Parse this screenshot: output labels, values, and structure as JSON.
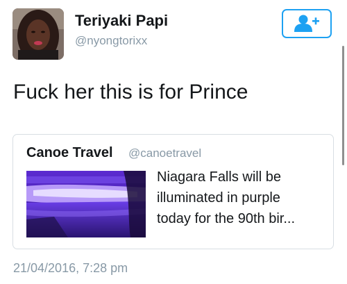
{
  "author": {
    "name": "Teriyaki Papi",
    "handle": "@nyongtorixx"
  },
  "follow_button": {
    "icon": "add-user-icon",
    "color": "#1da1f2"
  },
  "tweet": {
    "text": "Fuck her this is for Prince"
  },
  "quoted": {
    "name": "Canoe Travel",
    "handle": "@canoetravel",
    "lines": [
      "Niagara Falls will be",
      "illuminated in purple",
      "today for the 90th bir..."
    ]
  },
  "timestamp": "21/04/2016, 7:28 pm",
  "colors": {
    "accent": "#1da1f2",
    "secondary_text": "#8899a6",
    "falls_purple": "#7a3fe0"
  }
}
